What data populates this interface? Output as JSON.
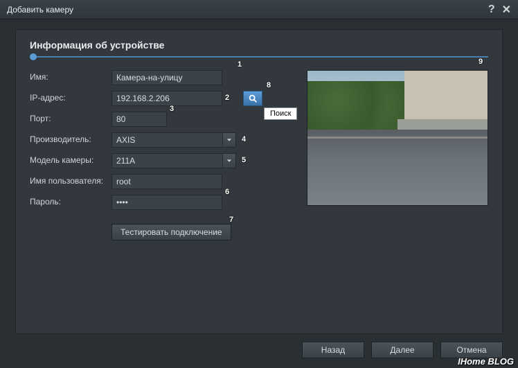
{
  "titlebar": {
    "title": "Добавить камеру"
  },
  "section": {
    "title": "Информация об устройстве"
  },
  "form": {
    "name_label": "Имя:",
    "name_value": "Камера-на-улицу",
    "ip_label": "IP-адрес:",
    "ip_value": "192.168.2.206",
    "port_label": "Порт:",
    "port_value": "80",
    "manufacturer_label": "Производитель:",
    "manufacturer_value": "AXIS",
    "model_label": "Модель камеры:",
    "model_value": "211A",
    "username_label": "Имя пользователя:",
    "username_value": "root",
    "password_label": "Пароль:",
    "password_value": "••••",
    "test_btn": "Тестировать подключение",
    "search_tooltip": "Поиск"
  },
  "annotations": {
    "a1": "1",
    "a2": "2",
    "a3": "3",
    "a4": "4",
    "a5": "5",
    "a6": "6",
    "a7": "7",
    "a8": "8",
    "a9": "9"
  },
  "footer": {
    "back": "Назад",
    "next": "Далее",
    "cancel": "Отмена"
  },
  "watermark": "IHome BLOG"
}
